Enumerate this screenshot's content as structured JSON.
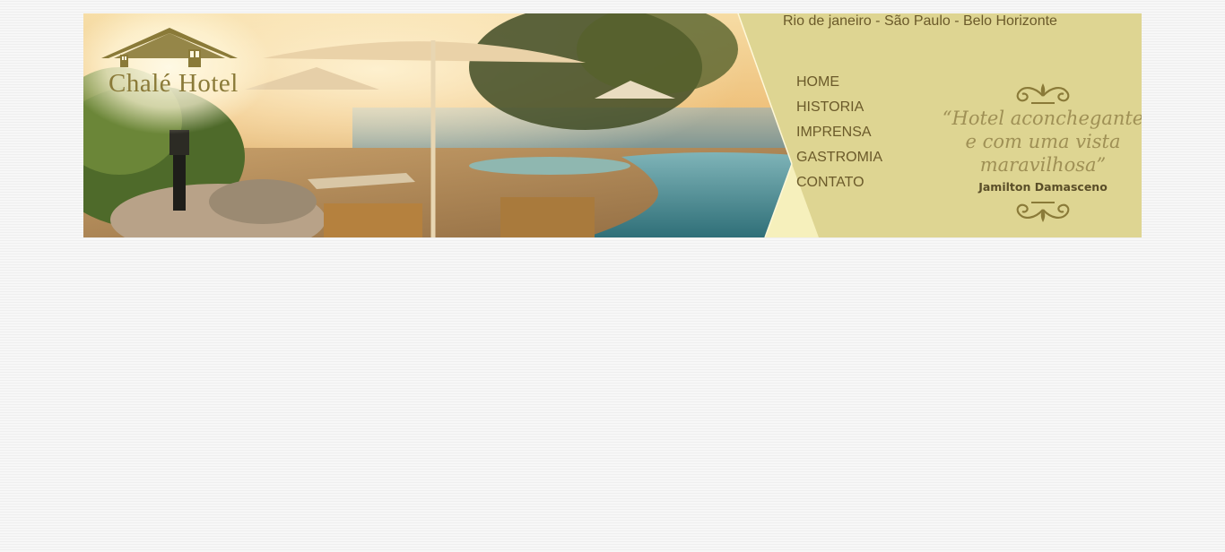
{
  "header": {
    "logo_text": "Chalé Hotel",
    "location": "Rio de janeiro - São Paulo - Belo Horizonte"
  },
  "nav": {
    "items": [
      {
        "label": "HOME"
      },
      {
        "label": "HISTORIA"
      },
      {
        "label": "IMPRENSA"
      },
      {
        "label": "GASTROMIA"
      },
      {
        "label": "CONTATO"
      }
    ]
  },
  "quote": {
    "text": "“Hotel aconchegante e com uma vista maravilhosa”",
    "author": "Jamilton Damasceno"
  },
  "colors": {
    "panel": "#ded592",
    "panel_light": "#f6f0bc",
    "nav_text": "#6b5a2a",
    "logo": "#8a7a38",
    "page_background": "#f4f4f4"
  }
}
